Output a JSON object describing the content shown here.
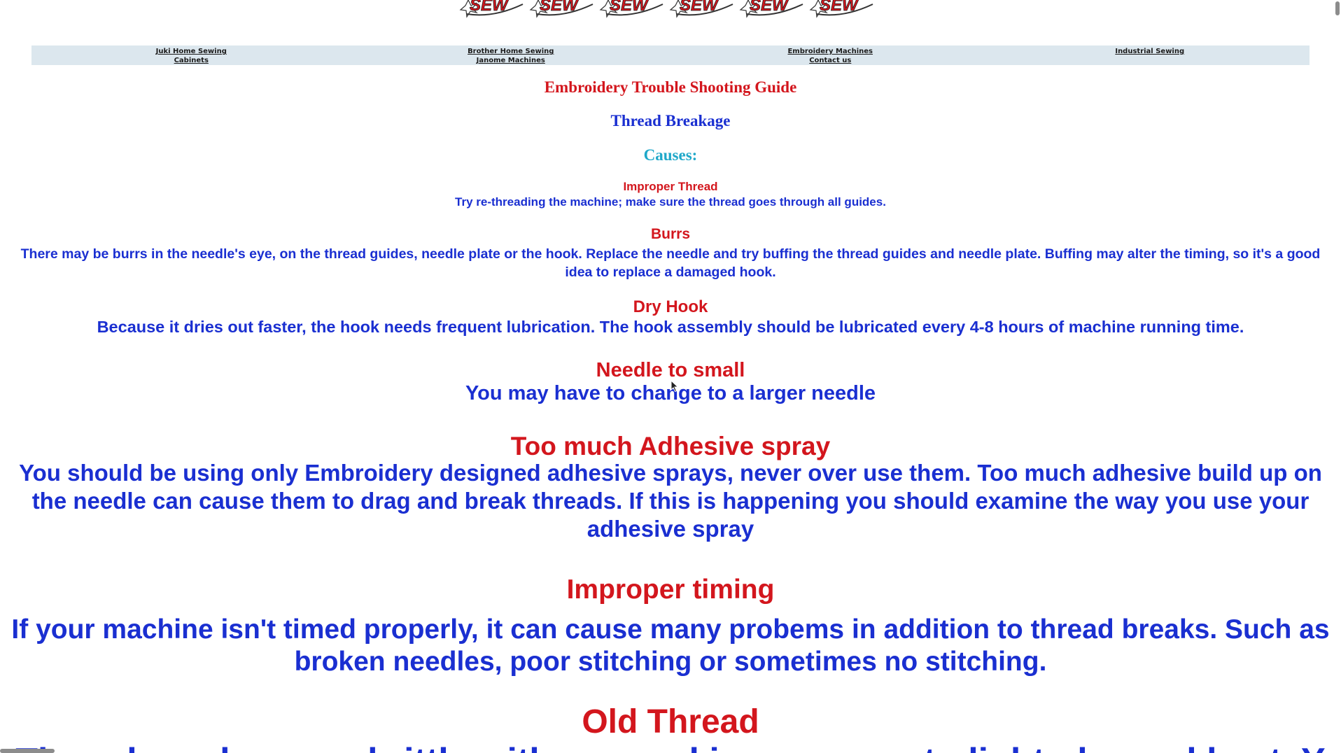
{
  "logo": {
    "text": "SEW",
    "count": 6
  },
  "nav": {
    "columns": [
      {
        "links": [
          "Juki Home Sewing",
          "Cabinets"
        ]
      },
      {
        "links": [
          "Brother Home Sewing",
          "Janome Machines"
        ]
      },
      {
        "links": [
          "Embroidery Machines",
          "Contact us"
        ]
      },
      {
        "links": [
          "Industrial Sewing"
        ]
      }
    ]
  },
  "page": {
    "title": "Embroidery Trouble Shooting Guide",
    "subtitle": "Thread Breakage",
    "causes_label": "Causes:"
  },
  "causes": [
    {
      "heading": "Improper Thread",
      "text": "Try re-threading the machine; make sure the thread goes through all guides."
    },
    {
      "heading": "Burrs",
      "text": "There may be burrs in the needle's eye, on the thread guides, needle plate or the hook. Replace the needle and try buffing the thread guides and needle plate. Buffing may alter the timing, so it's a good idea to replace a damaged hook."
    },
    {
      "heading": "Dry Hook",
      "text": "Because it dries out faster, the hook needs frequent lubrication. The hook assembly should be lubricated every 4-8 hours of machine running time."
    },
    {
      "heading": "Needle to small",
      "text": "You may have to change to a larger needle"
    },
    {
      "heading": "Too much Adhesive spray",
      "text": "You should be using only Embroidery designed adhesive sprays, never over use them. Too much adhesive build up on the needle can cause them to drag and break threads. If this is happening you should examine the way you use your adhesive spray"
    },
    {
      "heading": "Improper timing",
      "text": "If your machine isn't timed properly, it can cause many probems in addition to thread breaks. Such as broken needles, poor stitching or sometimes no stitching."
    },
    {
      "heading": "Old Thread",
      "text": "Thread can become brittle with age and in exposure to light, dry and heat. Y"
    }
  ],
  "colors": {
    "heading_red": "#d3161d",
    "body_blue": "#1a2fd1",
    "causes_teal": "#1fa8c9",
    "nav_bg": "#dce7ee"
  }
}
